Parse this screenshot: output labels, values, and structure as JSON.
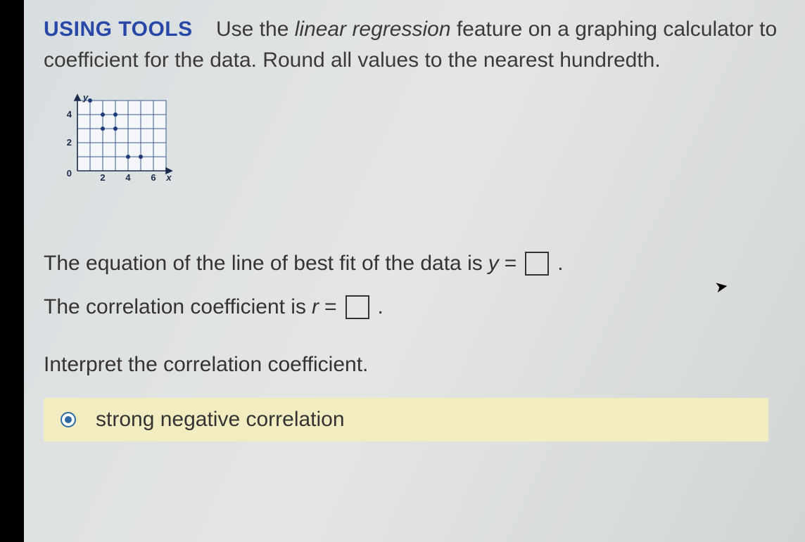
{
  "heading": {
    "label": "USING TOOLS",
    "line1_pre": "Use the ",
    "line1_italic": "linear regression",
    "line1_post": " feature on a graphing calculator to",
    "line2": "coefficient for the data. Round all values to the nearest hundredth."
  },
  "chart_data": {
    "type": "scatter",
    "title": "",
    "xlabel": "x",
    "ylabel": "y",
    "xlim": [
      0,
      7
    ],
    "ylim": [
      0,
      5.5
    ],
    "xticks": [
      0,
      2,
      4,
      6
    ],
    "yticks": [
      0,
      2,
      4
    ],
    "points": [
      {
        "x": 1,
        "y": 5
      },
      {
        "x": 2,
        "y": 4
      },
      {
        "x": 2,
        "y": 3
      },
      {
        "x": 3,
        "y": 4
      },
      {
        "x": 3,
        "y": 3
      },
      {
        "x": 4,
        "y": 1
      },
      {
        "x": 5,
        "y": 1
      }
    ]
  },
  "q1": {
    "text": "The equation of the line of best fit of the data is ",
    "var": "y",
    "eq": " = ",
    "period": "."
  },
  "q2": {
    "text": "The correlation coefficient is ",
    "var": "r",
    "eq": " = ",
    "period": "."
  },
  "interpret": {
    "text": "Interpret the correlation coefficient."
  },
  "option": {
    "selected": true,
    "label": "strong negative correlation"
  }
}
